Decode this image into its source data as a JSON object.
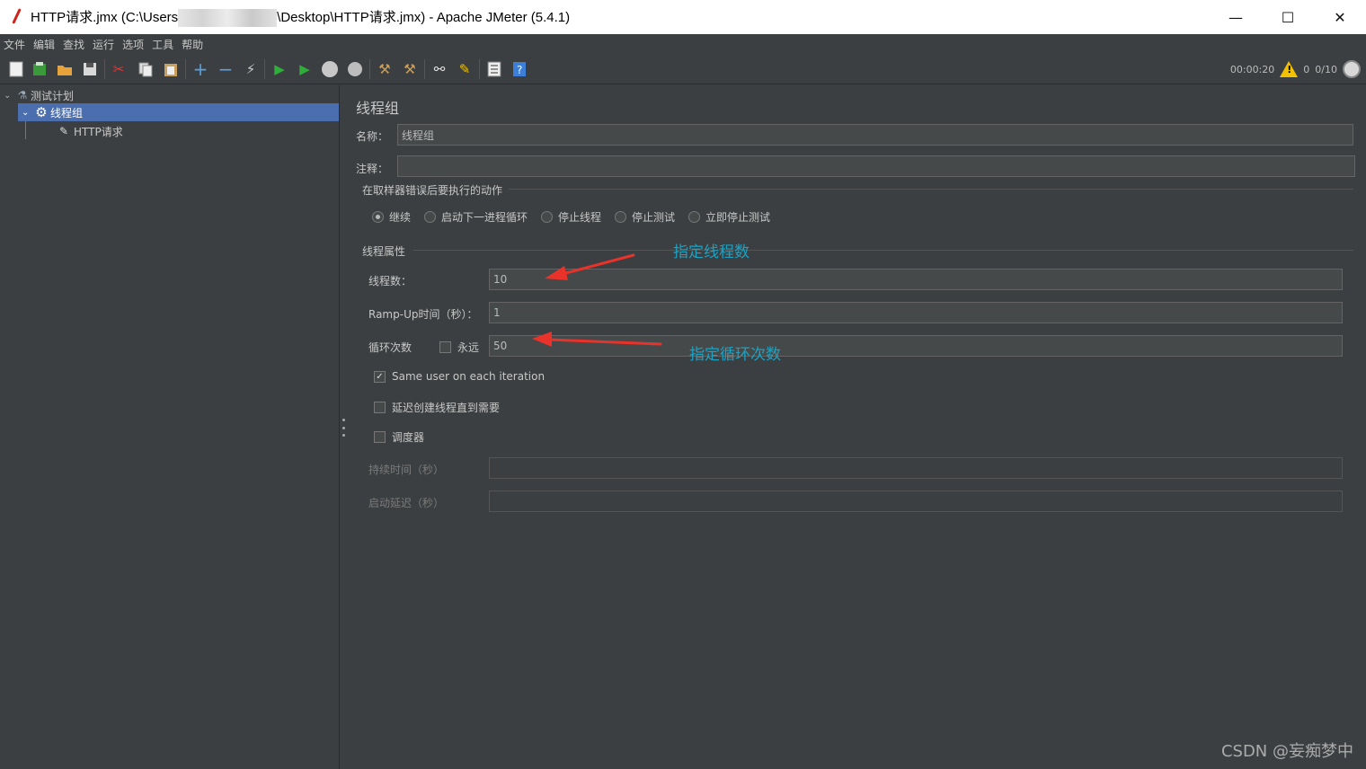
{
  "window": {
    "title_prefix": "HTTP请求.jmx (C:\\Users",
    "title_suffix": "\\Desktop\\HTTP请求.jmx) - Apache JMeter (5.4.1)",
    "minimize": "—",
    "maximize": "☐",
    "close": "✕"
  },
  "menu": [
    "文件",
    "编辑",
    "查找",
    "运行",
    "选项",
    "工具",
    "帮助"
  ],
  "toolbar": {
    "timer": "00:00:20",
    "warnings": "0",
    "threads": "0/10"
  },
  "tree": {
    "root": "测试计划",
    "thread_group": "线程组",
    "sampler": "HTTP请求"
  },
  "panel": {
    "title": "线程组",
    "name_label": "名称：",
    "name_value": "线程组",
    "comment_label": "注释：",
    "comment_value": "",
    "error_group_title": "在取样器错误后要执行的动作",
    "error_actions": [
      "继续",
      "启动下一进程循环",
      "停止线程",
      "停止测试",
      "立即停止测试"
    ],
    "error_action_selected": 0,
    "thread_props_title": "线程属性",
    "threads_label": "线程数：",
    "threads_value": "10",
    "rampup_label": "Ramp-Up时间（秒）：",
    "rampup_value": "1",
    "loop_label": "循环次数",
    "forever_label": "永远",
    "forever_checked": false,
    "loop_value": "50",
    "same_user_label": "Same user on each iteration",
    "same_user_checked": true,
    "delay_label": "延迟创建线程直到需要",
    "delay_checked": false,
    "scheduler_label": "调度器",
    "scheduler_checked": false,
    "duration_label": "持续时间（秒）",
    "duration_value": "",
    "startup_delay_label": "启动延迟（秒）",
    "startup_delay_value": ""
  },
  "annotations": {
    "threads_note": "指定线程数",
    "loops_note": "指定循环次数",
    "color": "#1aa3c5",
    "arrow_color": "#e8322a"
  },
  "watermark": "CSDN @妄痴梦中"
}
